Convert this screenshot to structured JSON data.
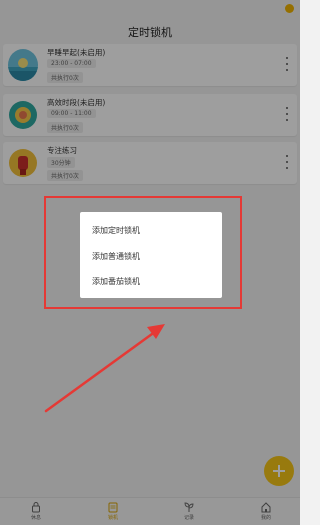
{
  "header": {
    "title": "定时锁机"
  },
  "cards": [
    {
      "name": "早睡早起(未启用)",
      "time": "23:00 - 07:00",
      "runs": "共执行0次"
    },
    {
      "name": "高效时段(未启用)",
      "time": "09:00 - 11:00",
      "runs": "共执行0次"
    },
    {
      "name": "专注练习",
      "time": "30分钟",
      "runs": "共执行0次"
    }
  ],
  "popup": {
    "items": [
      "添加定时锁机",
      "添加普通锁机",
      "添加番茄锁机"
    ]
  },
  "nav": {
    "items": [
      "休息",
      "锁机",
      "记录",
      "我的"
    ]
  },
  "colors": {
    "accent": "#f5c518",
    "annotation": "#e53935"
  }
}
